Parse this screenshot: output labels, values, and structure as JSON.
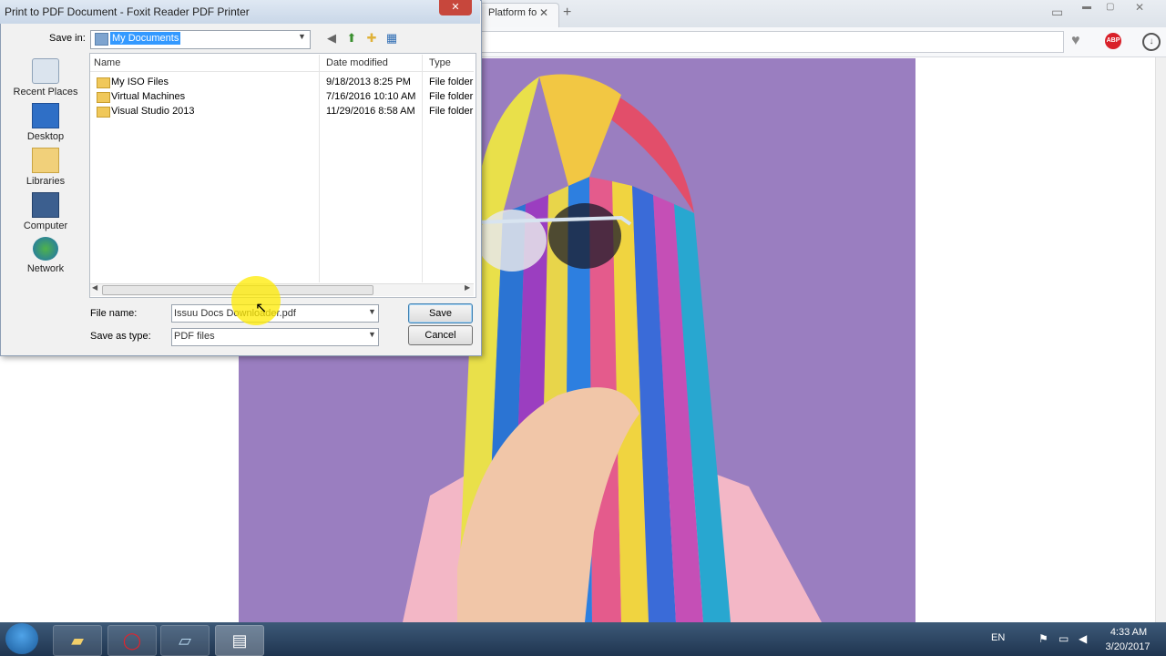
{
  "browser": {
    "tab_title": "Platform fo",
    "tab_close": "✕",
    "new_tab": "+",
    "abp_label": "ABP"
  },
  "dialog": {
    "title": "Print to PDF Document - Foxit Reader PDF Printer",
    "close_glyph": "✕",
    "save_in_label": "Save in:",
    "save_in_value": "My Documents",
    "places": [
      {
        "label": "Recent Places",
        "icon": "recent-places-icon"
      },
      {
        "label": "Desktop",
        "icon": "desktop-icon"
      },
      {
        "label": "Libraries",
        "icon": "libraries-icon"
      },
      {
        "label": "Computer",
        "icon": "computer-icon"
      },
      {
        "label": "Network",
        "icon": "network-icon"
      }
    ],
    "columns": {
      "name": "Name",
      "date": "Date modified",
      "type": "Type"
    },
    "files": [
      {
        "name": "My ISO Files",
        "date": "9/18/2013 8:25 PM",
        "type": "File folder"
      },
      {
        "name": "Virtual Machines",
        "date": "7/16/2016 10:10 AM",
        "type": "File folder"
      },
      {
        "name": "Visual Studio 2013",
        "date": "11/29/2016 8:58 AM",
        "type": "File folder"
      }
    ],
    "file_name_label": "File name:",
    "file_name_value": "Issuu Docs Downloader.pdf",
    "save_as_type_label": "Save as type:",
    "save_as_type_value": "PDF files",
    "save_button": "Save",
    "cancel_button": "Cancel"
  },
  "taskbar": {
    "apps": [
      {
        "name": "Windows Explorer",
        "icon": "folder-icon"
      },
      {
        "name": "Opera",
        "icon": "opera-icon"
      },
      {
        "name": "Notepad",
        "icon": "notepad-icon"
      },
      {
        "name": "Foxit Reader",
        "icon": "foxit-icon"
      }
    ],
    "language": "EN",
    "time": "4:33 AM",
    "date": "3/20/2017"
  },
  "colors": {
    "selection": "#3399ff",
    "photo_background": "#9b7fc0",
    "taskbar": "#2a4563",
    "abp_red": "#d9212a"
  }
}
